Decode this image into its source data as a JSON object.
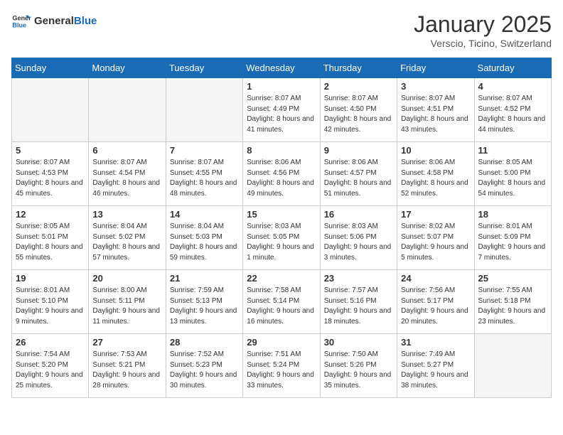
{
  "header": {
    "logo_general": "General",
    "logo_blue": "Blue",
    "month": "January 2025",
    "location": "Verscio, Ticino, Switzerland"
  },
  "days_of_week": [
    "Sunday",
    "Monday",
    "Tuesday",
    "Wednesday",
    "Thursday",
    "Friday",
    "Saturday"
  ],
  "weeks": [
    [
      {
        "day": "",
        "empty": true
      },
      {
        "day": "",
        "empty": true
      },
      {
        "day": "",
        "empty": true
      },
      {
        "day": "1",
        "sunrise": "8:07 AM",
        "sunset": "4:49 PM",
        "daylight": "8 hours and 41 minutes."
      },
      {
        "day": "2",
        "sunrise": "8:07 AM",
        "sunset": "4:50 PM",
        "daylight": "8 hours and 42 minutes."
      },
      {
        "day": "3",
        "sunrise": "8:07 AM",
        "sunset": "4:51 PM",
        "daylight": "8 hours and 43 minutes."
      },
      {
        "day": "4",
        "sunrise": "8:07 AM",
        "sunset": "4:52 PM",
        "daylight": "8 hours and 44 minutes."
      }
    ],
    [
      {
        "day": "5",
        "sunrise": "8:07 AM",
        "sunset": "4:53 PM",
        "daylight": "8 hours and 45 minutes."
      },
      {
        "day": "6",
        "sunrise": "8:07 AM",
        "sunset": "4:54 PM",
        "daylight": "8 hours and 46 minutes."
      },
      {
        "day": "7",
        "sunrise": "8:07 AM",
        "sunset": "4:55 PM",
        "daylight": "8 hours and 48 minutes."
      },
      {
        "day": "8",
        "sunrise": "8:06 AM",
        "sunset": "4:56 PM",
        "daylight": "8 hours and 49 minutes."
      },
      {
        "day": "9",
        "sunrise": "8:06 AM",
        "sunset": "4:57 PM",
        "daylight": "8 hours and 51 minutes."
      },
      {
        "day": "10",
        "sunrise": "8:06 AM",
        "sunset": "4:58 PM",
        "daylight": "8 hours and 52 minutes."
      },
      {
        "day": "11",
        "sunrise": "8:05 AM",
        "sunset": "5:00 PM",
        "daylight": "8 hours and 54 minutes."
      }
    ],
    [
      {
        "day": "12",
        "sunrise": "8:05 AM",
        "sunset": "5:01 PM",
        "daylight": "8 hours and 55 minutes."
      },
      {
        "day": "13",
        "sunrise": "8:04 AM",
        "sunset": "5:02 PM",
        "daylight": "8 hours and 57 minutes."
      },
      {
        "day": "14",
        "sunrise": "8:04 AM",
        "sunset": "5:03 PM",
        "daylight": "8 hours and 59 minutes."
      },
      {
        "day": "15",
        "sunrise": "8:03 AM",
        "sunset": "5:05 PM",
        "daylight": "9 hours and 1 minute."
      },
      {
        "day": "16",
        "sunrise": "8:03 AM",
        "sunset": "5:06 PM",
        "daylight": "9 hours and 3 minutes."
      },
      {
        "day": "17",
        "sunrise": "8:02 AM",
        "sunset": "5:07 PM",
        "daylight": "9 hours and 5 minutes."
      },
      {
        "day": "18",
        "sunrise": "8:01 AM",
        "sunset": "5:09 PM",
        "daylight": "9 hours and 7 minutes."
      }
    ],
    [
      {
        "day": "19",
        "sunrise": "8:01 AM",
        "sunset": "5:10 PM",
        "daylight": "9 hours and 9 minutes."
      },
      {
        "day": "20",
        "sunrise": "8:00 AM",
        "sunset": "5:11 PM",
        "daylight": "9 hours and 11 minutes."
      },
      {
        "day": "21",
        "sunrise": "7:59 AM",
        "sunset": "5:13 PM",
        "daylight": "9 hours and 13 minutes."
      },
      {
        "day": "22",
        "sunrise": "7:58 AM",
        "sunset": "5:14 PM",
        "daylight": "9 hours and 16 minutes."
      },
      {
        "day": "23",
        "sunrise": "7:57 AM",
        "sunset": "5:16 PM",
        "daylight": "9 hours and 18 minutes."
      },
      {
        "day": "24",
        "sunrise": "7:56 AM",
        "sunset": "5:17 PM",
        "daylight": "9 hours and 20 minutes."
      },
      {
        "day": "25",
        "sunrise": "7:55 AM",
        "sunset": "5:18 PM",
        "daylight": "9 hours and 23 minutes."
      }
    ],
    [
      {
        "day": "26",
        "sunrise": "7:54 AM",
        "sunset": "5:20 PM",
        "daylight": "9 hours and 25 minutes."
      },
      {
        "day": "27",
        "sunrise": "7:53 AM",
        "sunset": "5:21 PM",
        "daylight": "9 hours and 28 minutes."
      },
      {
        "day": "28",
        "sunrise": "7:52 AM",
        "sunset": "5:23 PM",
        "daylight": "9 hours and 30 minutes."
      },
      {
        "day": "29",
        "sunrise": "7:51 AM",
        "sunset": "5:24 PM",
        "daylight": "9 hours and 33 minutes."
      },
      {
        "day": "30",
        "sunrise": "7:50 AM",
        "sunset": "5:26 PM",
        "daylight": "9 hours and 35 minutes."
      },
      {
        "day": "31",
        "sunrise": "7:49 AM",
        "sunset": "5:27 PM",
        "daylight": "9 hours and 38 minutes."
      },
      {
        "day": "",
        "empty": true
      }
    ]
  ]
}
